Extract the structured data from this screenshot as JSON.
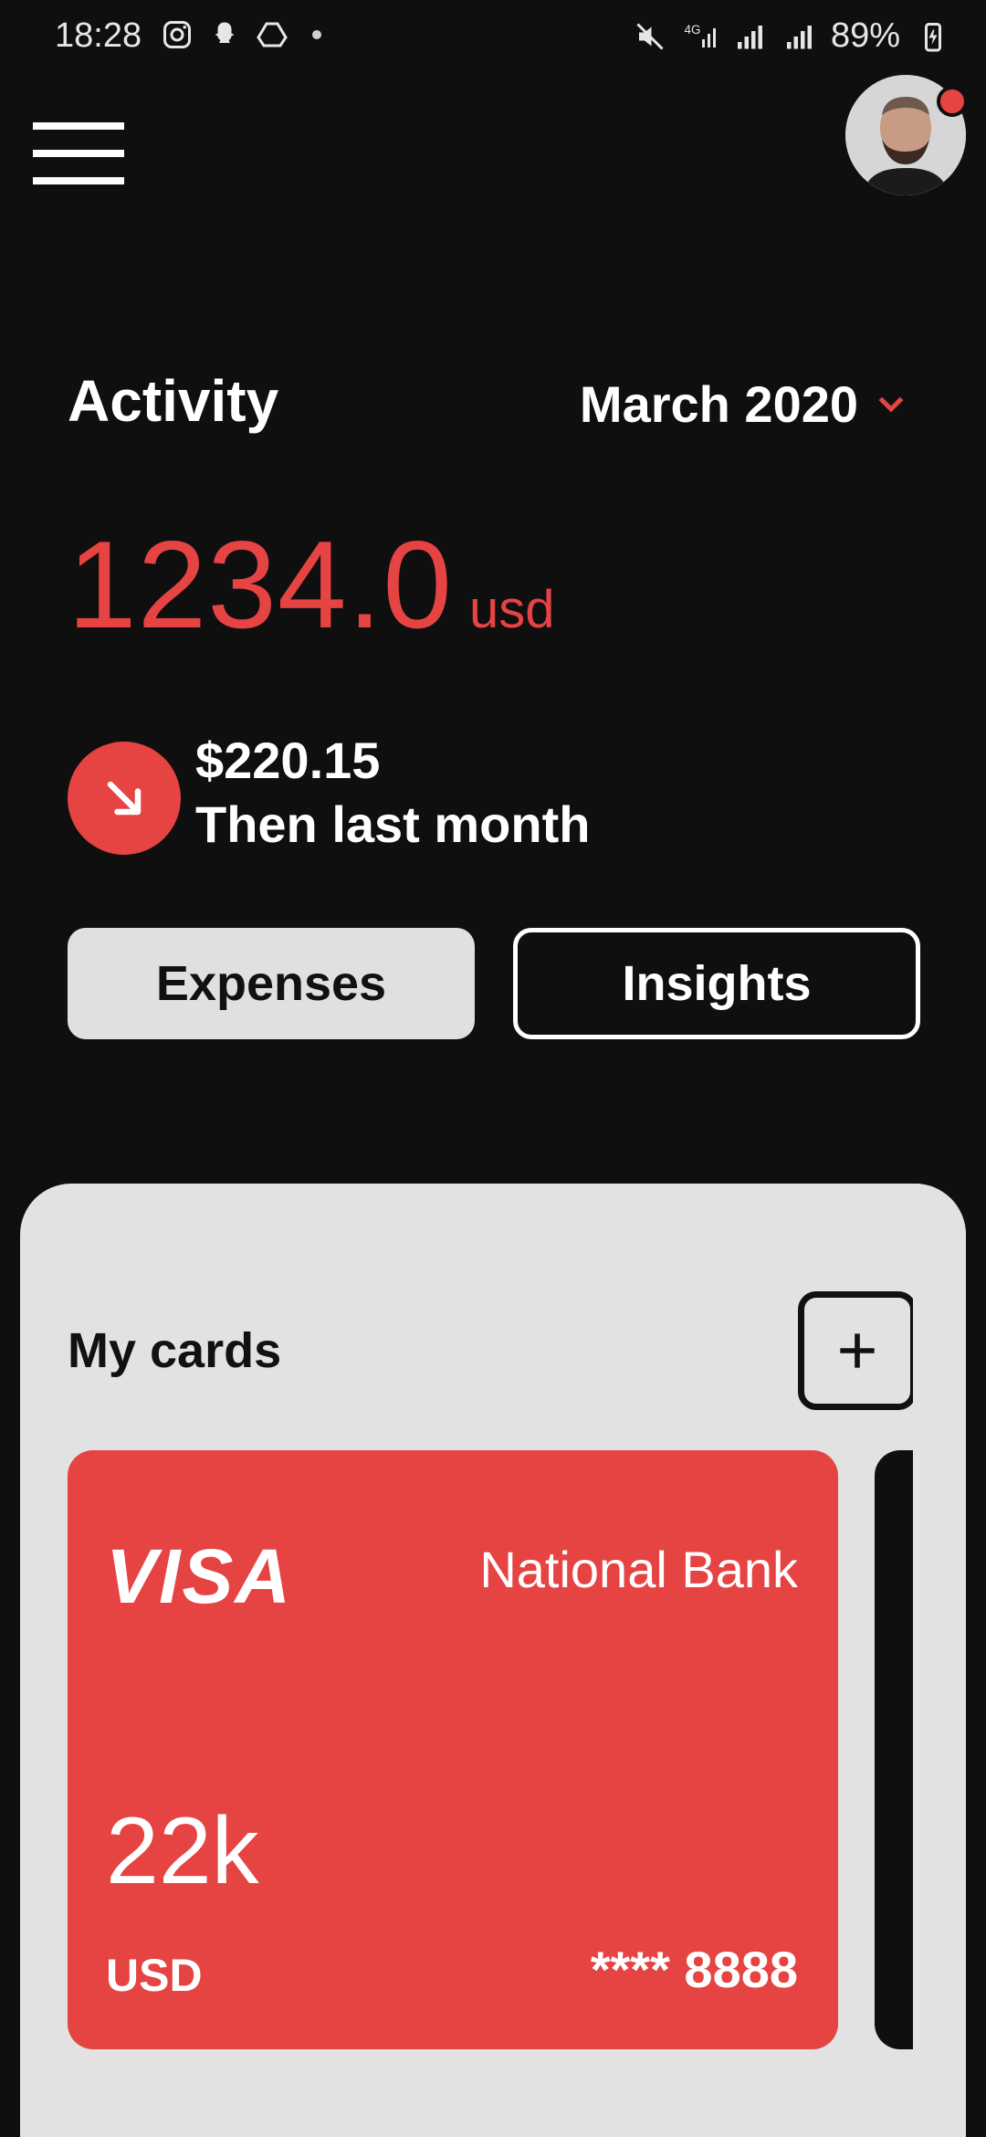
{
  "status_bar": {
    "time": "18:28",
    "battery": "89%",
    "left_icons": [
      "instagram-icon",
      "snapchat-icon",
      "drive-icon",
      "dot-icon"
    ],
    "right_icons": [
      "mute-icon",
      "4g-signal-icon",
      "signal-icon",
      "signal-icon",
      "battery-charging-icon"
    ]
  },
  "header": {
    "menu_icon": "hamburger-icon",
    "notification_color": "#e64343"
  },
  "activity": {
    "title": "Activity",
    "month": "March 2020",
    "amount": "1234.0",
    "unit": "usd",
    "change_amount": "$220.15",
    "change_label": "Then last month",
    "change_icon": "arrow-down-right-icon"
  },
  "tabs": {
    "expenses": "Expenses",
    "insights": "Insights"
  },
  "cards": {
    "title": "My cards",
    "add_icon": "plus-icon",
    "items": [
      {
        "brand": "VISA",
        "bank": "National Bank",
        "balance": "22k",
        "currency": "USD",
        "number": "**** 8888",
        "color": "#e64343"
      }
    ]
  },
  "colors": {
    "accent": "#e64343",
    "background": "#0f0f10",
    "panel": "#e2e2e2"
  }
}
